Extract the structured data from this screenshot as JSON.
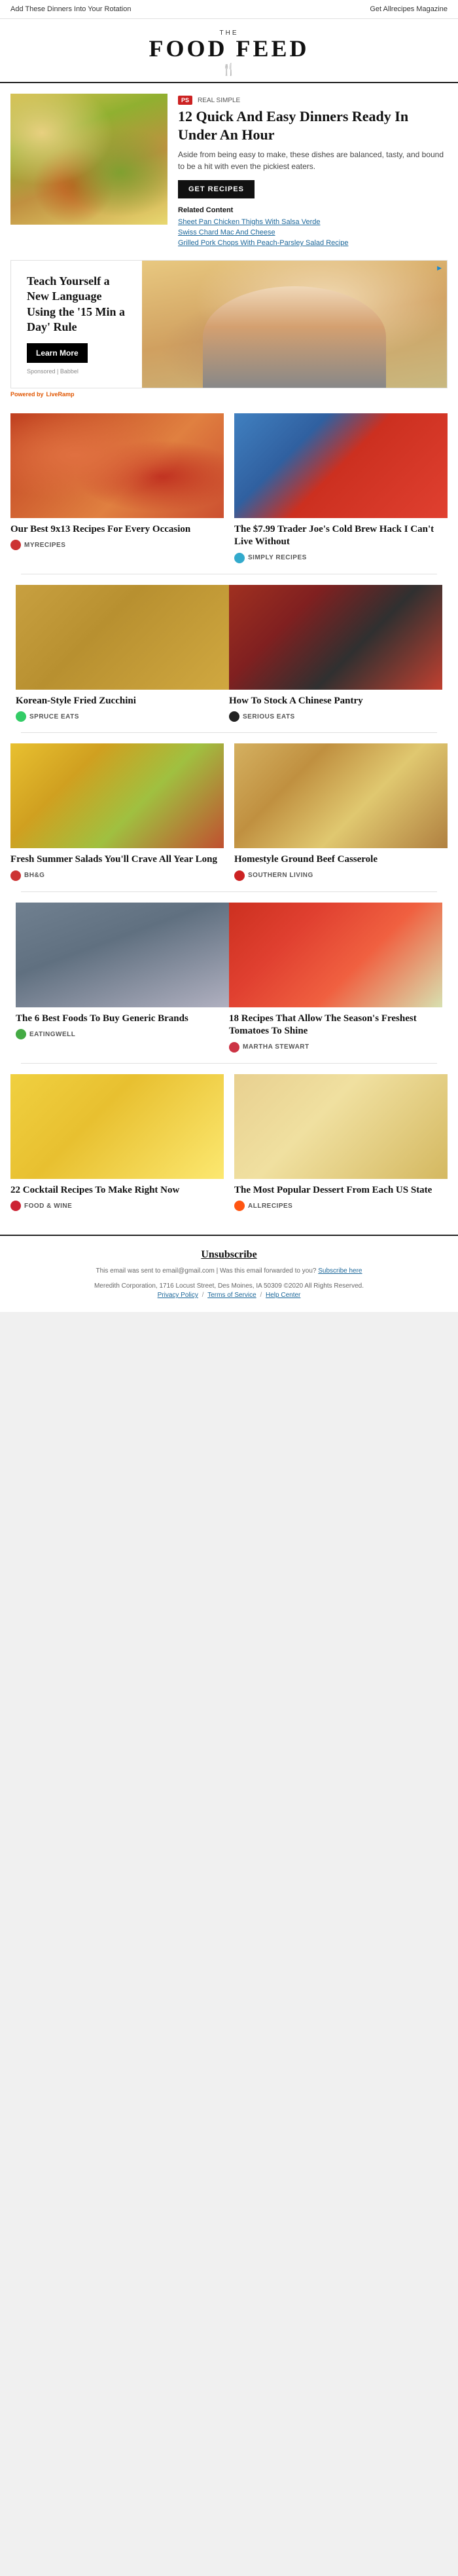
{
  "topBar": {
    "leftLink": "Add These Dinners Into Your Rotation",
    "rightLink": "Get Allrecipes Magazine"
  },
  "header": {
    "the": "THE",
    "title": "FOOD FEED",
    "forkSymbol": "🍴"
  },
  "hero": {
    "badge": "PS",
    "badgeLabel": "REAL SIMPLE",
    "title": "12 Quick And Easy Dinners Ready In Under An Hour",
    "description": "Aside from being easy to make, these dishes are balanced, tasty, and bound to be a hit with even the pickiest eaters.",
    "ctaButton": "GET RECIPES",
    "relatedTitle": "Related Content",
    "relatedLinks": [
      "Sheet Pan Chicken Thighs With Salsa Verde",
      "Swiss Chard Mac And Cheese",
      "Grilled Pork Chops With Peach-Parsley Salad Recipe"
    ]
  },
  "ad": {
    "title": "Teach Yourself a New Language Using the '15 Min a Day' Rule",
    "ctaButton": "Learn More",
    "sponsored": "Sponsored | Babbel",
    "poweredBy": "Powered by",
    "poweredByBrand": "LiveRamp"
  },
  "articles": [
    {
      "title": "Our Best 9x13 Recipes For Every Occasion",
      "source": "MYRECIPES",
      "sourceKey": "myrecipes",
      "thumbClass": "thumb-9x13"
    },
    {
      "title": "The $7.99 Trader Joe's Cold Brew Hack I Can't Live Without",
      "source": "SIMPLY RECIPES",
      "sourceKey": "simply",
      "thumbClass": "thumb-trader"
    },
    {
      "title": "Korean-Style Fried Zucchini",
      "source": "SPRUCE EATS",
      "sourceKey": "spruce",
      "thumbClass": "thumb-zucchini"
    },
    {
      "title": "How To Stock A Chinese Pantry",
      "source": "SERIOUS EATS",
      "sourceKey": "serious",
      "thumbClass": "thumb-chinese"
    },
    {
      "title": "Fresh Summer Salads You'll Crave All Year Long",
      "source": "BH&G",
      "sourceKey": "bhg",
      "thumbClass": "thumb-salads"
    },
    {
      "title": "Homestyle Ground Beef Casserole",
      "source": "SOUTHERN LIVING",
      "sourceKey": "southernliving",
      "thumbClass": "thumb-casserole"
    },
    {
      "title": "The 6 Best Foods To Buy Generic Brands",
      "source": "EATINGWELL",
      "sourceKey": "eatingwell",
      "thumbClass": "thumb-foods"
    },
    {
      "title": "18 Recipes That Allow The Season's Freshest Tomatoes To Shine",
      "source": "MARTHA STEWART",
      "sourceKey": "martha",
      "thumbClass": "thumb-tomatoes"
    },
    {
      "title": "22 Cocktail Recipes To Make Right Now",
      "source": "FOOD & WINE",
      "sourceKey": "foodwine",
      "thumbClass": "thumb-cocktails"
    },
    {
      "title": "The Most Popular Dessert From Each US State",
      "source": "ALLRECIPES",
      "sourceKey": "allrecipes",
      "thumbClass": "thumb-dessert"
    }
  ],
  "footer": {
    "unsubscribeLabel": "Unsubscribe",
    "emailInfo": "This email was sent to email@gmail.com | Was this email forwarded to you?",
    "subscribeLink": "Subscribe here",
    "company": "Meredith Corporation, 1716 Locust Street, Des Moines, IA 50309 ©2020 All Rights Reserved.",
    "privacyPolicy": "Privacy Policy",
    "termsOfService": "Terms of Service",
    "helpCenter": "Help Center"
  }
}
